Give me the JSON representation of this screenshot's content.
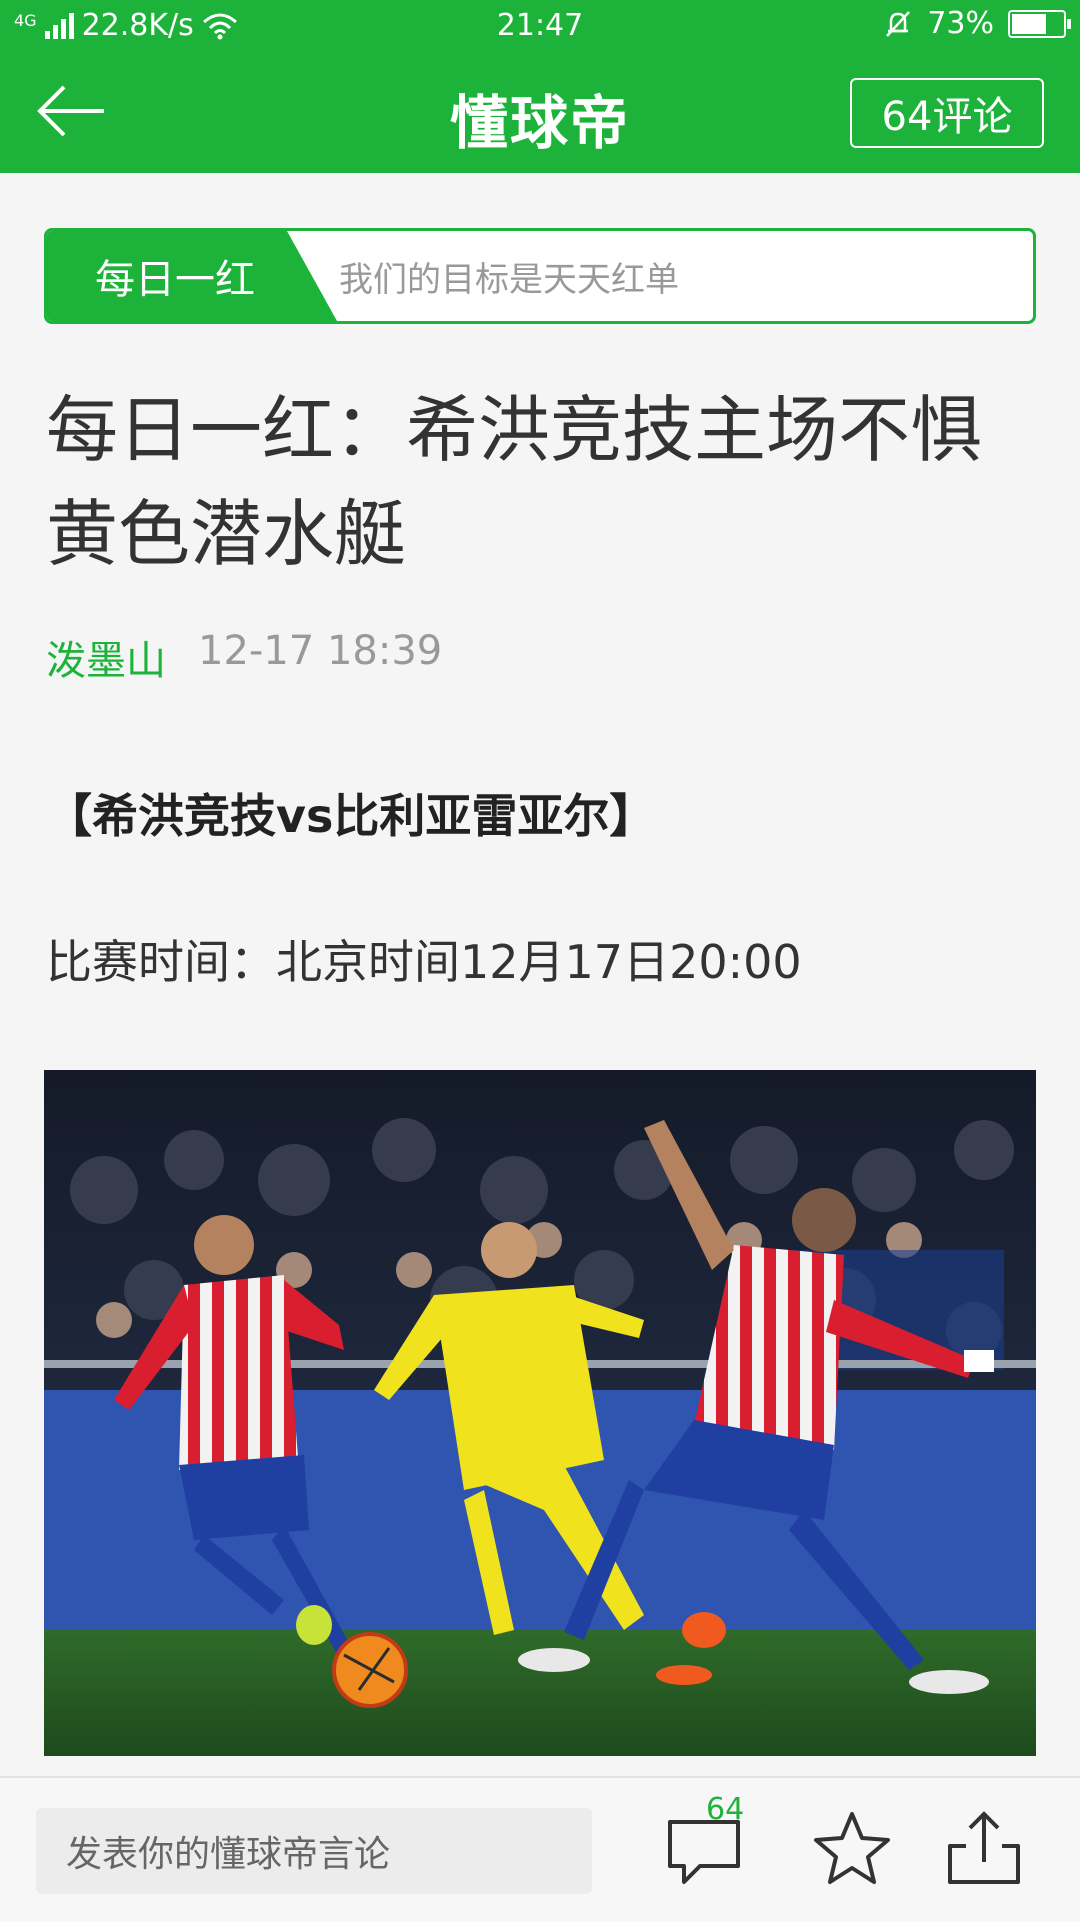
{
  "status_bar": {
    "network": "4G",
    "speed": "22.8K/s",
    "time": "21:47",
    "battery": "73%",
    "battery_level": 0.73
  },
  "header": {
    "brand": "懂球帝",
    "comment_button": "64评论"
  },
  "tag_banner": {
    "tag": "每日一红",
    "slogan": "我们的目标是天天红单"
  },
  "article": {
    "title": "每日一红：希洪竞技主场不惧黄色潜水艇",
    "author": "泼墨山",
    "date": "12-17 18:39",
    "subheading": "【希洪竞技vs比利亚雷亚尔】",
    "match_time": "比赛时间：北京时间12月17日20:00"
  },
  "bottom_bar": {
    "input_placeholder": "发表你的懂球帝言论",
    "comment_count": "64"
  },
  "icons": {
    "back": "back-arrow-icon",
    "comments": "comment-bubble-icon",
    "favorite": "star-icon",
    "share": "share-icon"
  },
  "colors": {
    "brand_green": "#1db33a"
  }
}
